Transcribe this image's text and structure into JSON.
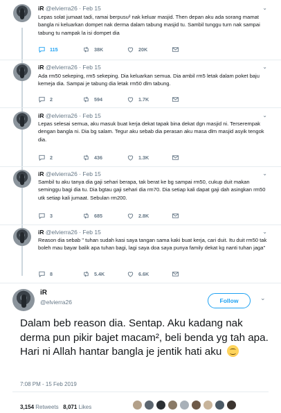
{
  "thread": [
    {
      "name": "iR",
      "handle": "@elvierra26",
      "date": "Feb 15",
      "text": "Lepas solat jumaat tadi, ramai berpusu² nak keluar masjid. Then depan aku ada sorang mamat bangla ni keluarkan dompet nak derma dalam tabung masjid tu. Sambil tunggu turn nak sampai tabung tu nampak la isi dompet dia",
      "replies": "115",
      "retweets": "38K",
      "likes": "20K"
    },
    {
      "name": "iR",
      "handle": "@elvierra26",
      "date": "Feb 15",
      "text": "Ada rm50 sekeping, rm5 sekeping. Dia keluarkan semua. Dia ambil rm5 letak dalam poket baju kemeja dia. Sampai je tabung dia letak rm50 dlm tabung.",
      "replies": "2",
      "retweets": "594",
      "likes": "1.7K"
    },
    {
      "name": "iR",
      "handle": "@elvierra26",
      "date": "Feb 15",
      "text": "Lepas selesai semua, aku masuk buat kerja dekat tapak bina dekat dgn masjid ni. Terserempak dengan bangla ni. Dia bg salam. Tegur aku sebab dia perasan aku masa dlm masjid asyik tengok dia.",
      "replies": "2",
      "retweets": "436",
      "likes": "1.3K"
    },
    {
      "name": "iR",
      "handle": "@elvierra26",
      "date": "Feb 15",
      "text": "Sambil tu aku tanya dia gaji sehari berapa, tak berat ke bg sampai rm50, cukup duit makan seminggu bagi dia tu. Dia bgtau gaji sehari dia rm70. Dia setiap kali dapat gaji dah asingkan rm50 utk setiap kali jumaat. Sebulan rm200.",
      "replies": "3",
      "retweets": "685",
      "likes": "2.8K"
    },
    {
      "name": "iR",
      "handle": "@elvierra26",
      "date": "Feb 15",
      "text": "Reason dia sebab \" tuhan sudah kasi saya tangan sama kaki buat kerja, cari duit. Itu duit rm50 tak boleh mau bayar balik apa tuhan bagi, lagi saya doa saya punya family dekat kg nanti tuhan jaga\"",
      "replies": "8",
      "retweets": "5.4K",
      "likes": "6.6K"
    }
  ],
  "main_tweet": {
    "name": "iR",
    "handle": "@elvierra26",
    "follow_label": "Follow",
    "text": "Dalam beb reason dia. Sentap. Aku kadang nak derma pun pikir bajet macam², beli benda yg tah apa. Hari ni Allah hantar bangla je jentik hati aku",
    "timestamp": "7:08 PM - 15 Feb 2019",
    "retweets_count": "3,154",
    "retweets_label": "Retweets",
    "likes_count": "8,071",
    "likes_label": "Likes"
  },
  "icons": {
    "reply": "reply-icon",
    "retweet": "retweet-icon",
    "like": "heart-icon",
    "dm": "envelope-icon",
    "more": "chevron-down-icon",
    "emoji": "smiling-face-emoji"
  },
  "colors": {
    "accent": "#1da1f2",
    "retweet_green": "#17bf63",
    "muted": "#657786"
  }
}
